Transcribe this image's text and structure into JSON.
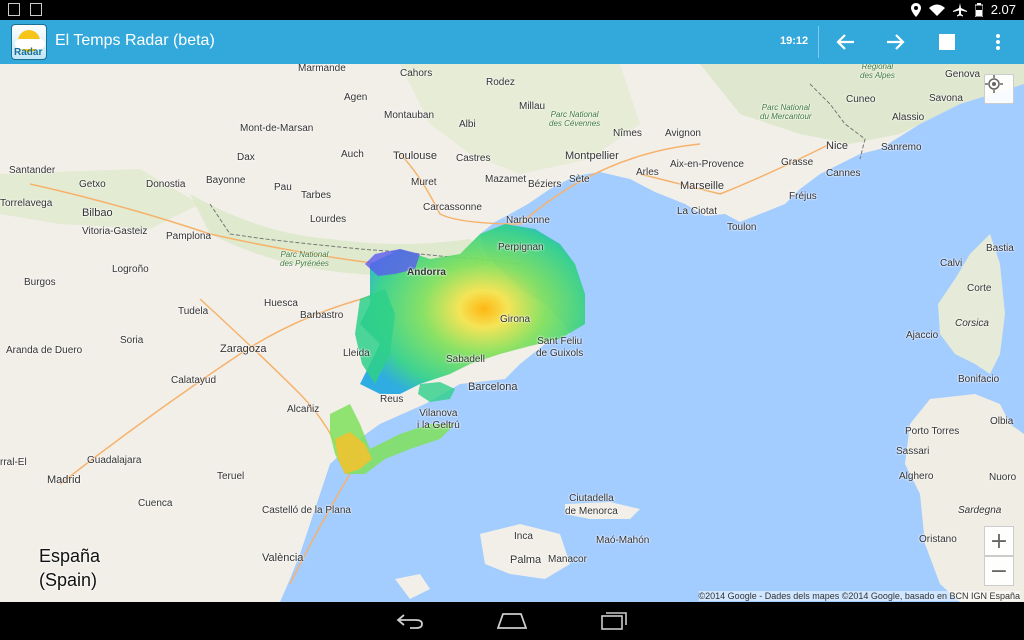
{
  "status_bar": {
    "time": "2.07"
  },
  "app_bar": {
    "logo_text": "Radar",
    "title": "El Temps Radar (beta)",
    "time": "19:12"
  },
  "map": {
    "labels": {
      "cahors": "Cahors",
      "marmande": "Marmande",
      "rodez": "Rodez",
      "agen": "Agen",
      "millau": "Millau",
      "montauban": "Montauban",
      "albi": "Albi",
      "mont_de_marsan": "Mont-de-Marsan",
      "dax": "Dax",
      "auch": "Auch",
      "toulouse": "Toulouse",
      "castres": "Castres",
      "montpellier": "Montpellier",
      "nimes": "Nîmes",
      "avignon": "Avignon",
      "arles": "Arles",
      "aix": "Aix-en-Provence",
      "marseille": "Marseille",
      "la_ciotat": "La Ciotat",
      "toulon": "Toulon",
      "frejus": "Fréjus",
      "cannes": "Cannes",
      "grasse": "Grasse",
      "nice": "Nice",
      "sanremo": "Sanremo",
      "cuneo": "Cuneo",
      "savona": "Savona",
      "genova": "Genova",
      "alassio": "Alassio",
      "bayonne": "Bayonne",
      "pau": "Pau",
      "tarbes": "Tarbes",
      "lourdes": "Lourdes",
      "muret": "Muret",
      "mazamet": "Mazamet",
      "beziers": "Béziers",
      "sete": "Sète",
      "carcassonne": "Carcassonne",
      "narbonne": "Narbonne",
      "perpignan": "Perpignan",
      "santander": "Santander",
      "torrelavega": "Torrelavega",
      "getxo": "Getxo",
      "donostia": "Donostia",
      "bilbao": "Bilbao",
      "vitoria": "Vitoria-Gasteiz",
      "pamplona": "Pamplona",
      "logrono": "Logroño",
      "burgos": "Burgos",
      "huesca": "Huesca",
      "tudela": "Tudela",
      "barbastro": "Barbastro",
      "andorra": "Andorra",
      "girona": "Girona",
      "sant_feliu": "Sant Feliu\nde Guixols",
      "lleida": "Lleida",
      "sabadell": "Sabadell",
      "barcelona": "Barcelona",
      "reus": "Reus",
      "vilanova": "Vilanova\ni la Geltrú",
      "zaragoza": "Zaragoza",
      "soria": "Soria",
      "aranda": "Aranda de Duero",
      "calatayud": "Calatayud",
      "alcaniz": "Alcañiz",
      "teruel": "Teruel",
      "guadalajara": "Guadalajara",
      "madrid": "Madrid",
      "cuenca": "Cuenca",
      "castello": "Castelló de la Plana",
      "valencia": "València",
      "espana": "España\n(Spain)",
      "ciutadella": "Ciutadella\nde Menorca",
      "mao": "Maó-Mahón",
      "inca": "Inca",
      "palma": "Palma",
      "manacor": "Manacor",
      "bastia": "Bastia",
      "calvi": "Calvi",
      "corte": "Corte",
      "corsica": "Corsica",
      "ajaccio": "Ajaccio",
      "bonifacio": "Bonifacio",
      "porto_torres": "Porto Torres",
      "olbia": "Olbia",
      "sassari": "Sassari",
      "alghero": "Alghero",
      "nuoro": "Nuoro",
      "sardegna": "Sardegna",
      "oristano": "Oristano",
      "cevennes": "Parc National\ndes Cévennes",
      "mercantour": "Parc National\ndu Mercantour",
      "pyrenees": "Parc National\ndes Pyrénées",
      "alpes": "Regional\ndes Alpes",
      "ra_el": "rral-El"
    },
    "attribution": "©2014 Google - Dades dels mapes ©2014 Google, basado en BCN IGN España",
    "zoom_in": "+",
    "zoom_out": "−"
  },
  "colors": {
    "app_bar": "#33a8db",
    "sea": "#a3ccff",
    "land": "#f2efe9"
  }
}
